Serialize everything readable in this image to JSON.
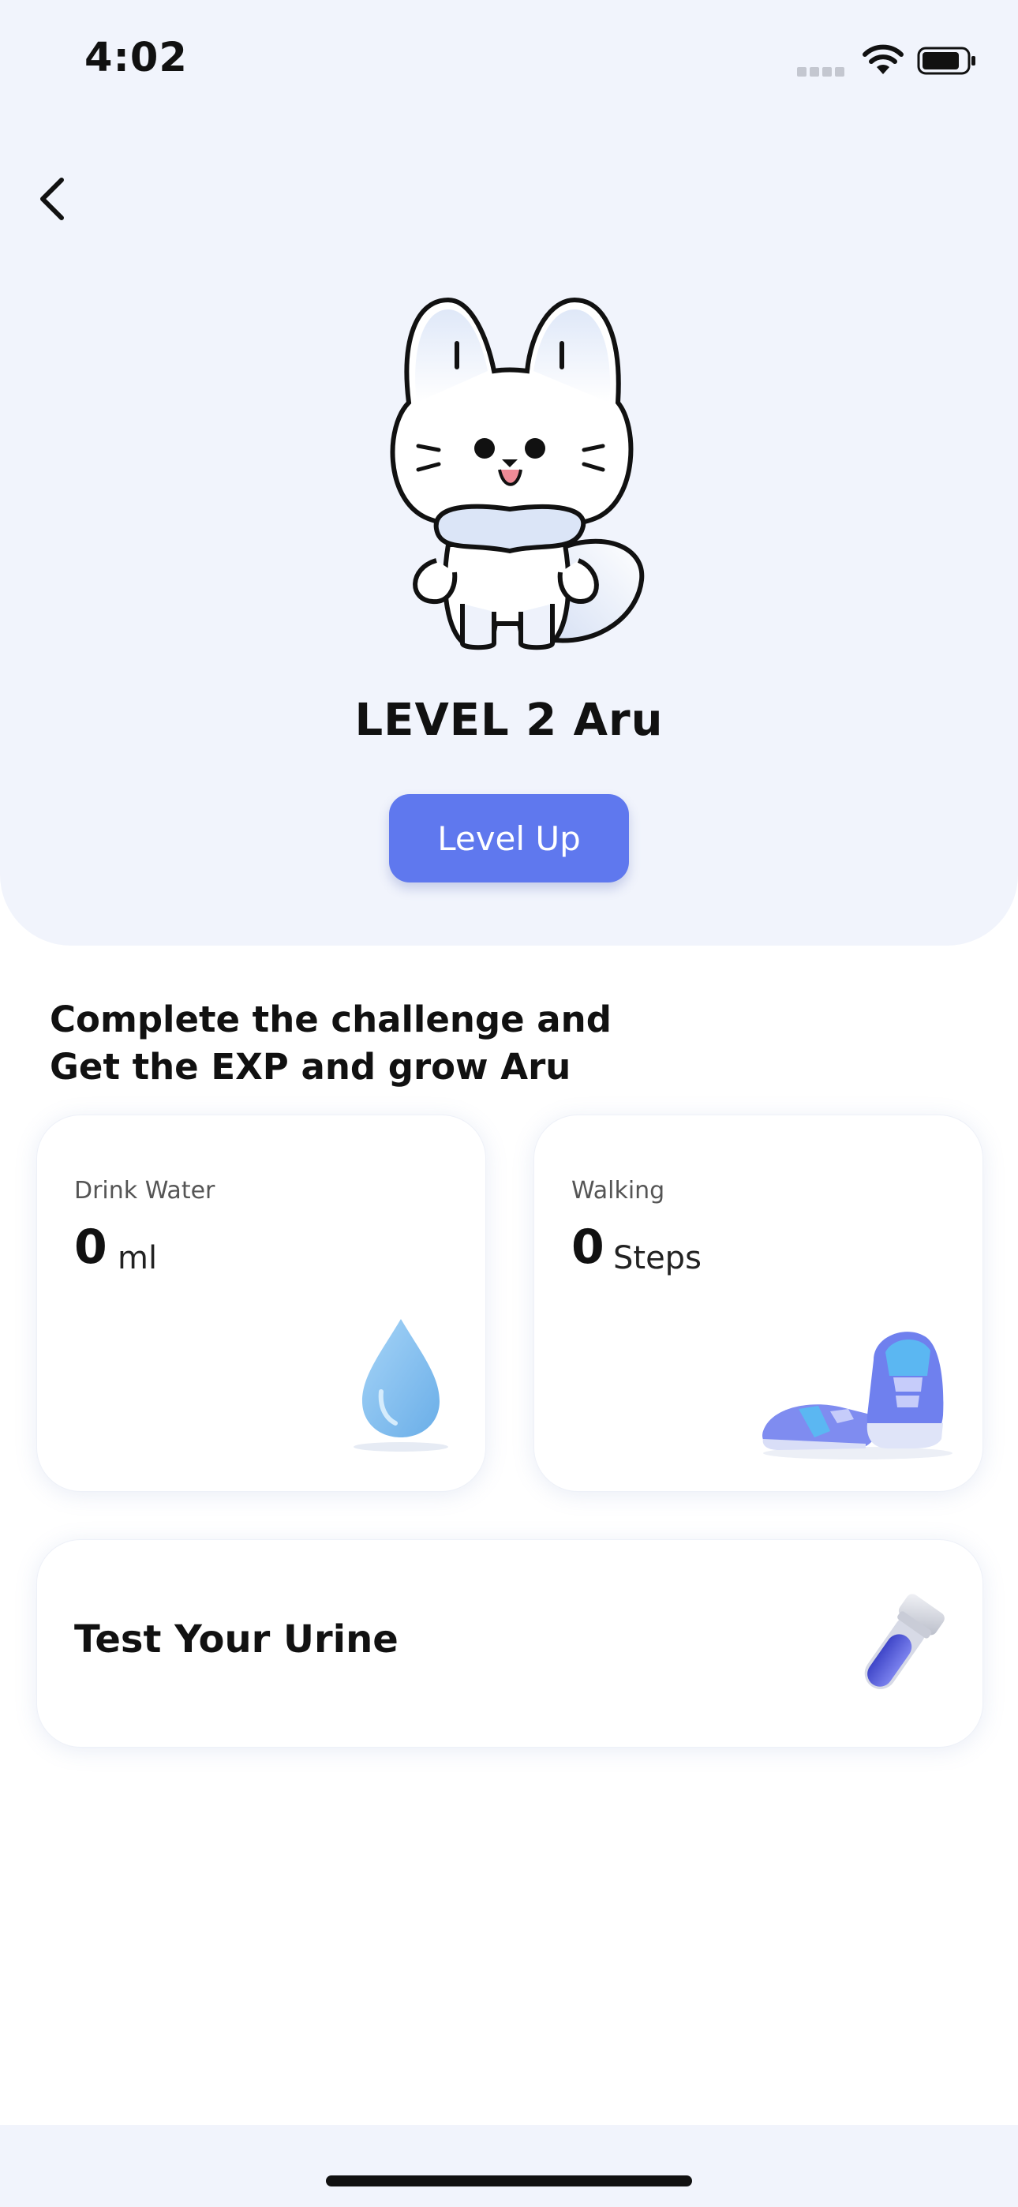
{
  "status_bar": {
    "time": "4:02",
    "icons": [
      "signal-icon",
      "wifi-icon",
      "battery-icon"
    ]
  },
  "header": {
    "back_icon": "chevron-left-icon"
  },
  "mascot": {
    "icon": "white-fox-character",
    "title": "LEVEL 2 Aru",
    "level_up_label": "Level Up"
  },
  "challenge": {
    "heading_line1": "Complete the challenge and",
    "heading_line2": "Get the EXP and grow Aru"
  },
  "cards": {
    "water": {
      "label": "Drink Water",
      "value": "0",
      "unit": "ml",
      "icon": "water-drop-icon"
    },
    "walking": {
      "label": "Walking",
      "value": "0",
      "unit": "Steps",
      "icon": "sneakers-icon"
    },
    "urine": {
      "label": "Test Your Urine",
      "icon": "test-tube-icon"
    }
  },
  "colors": {
    "accent": "#5f78ee",
    "hero_bg": "#f1f4fc",
    "water": "#7fbcee"
  }
}
